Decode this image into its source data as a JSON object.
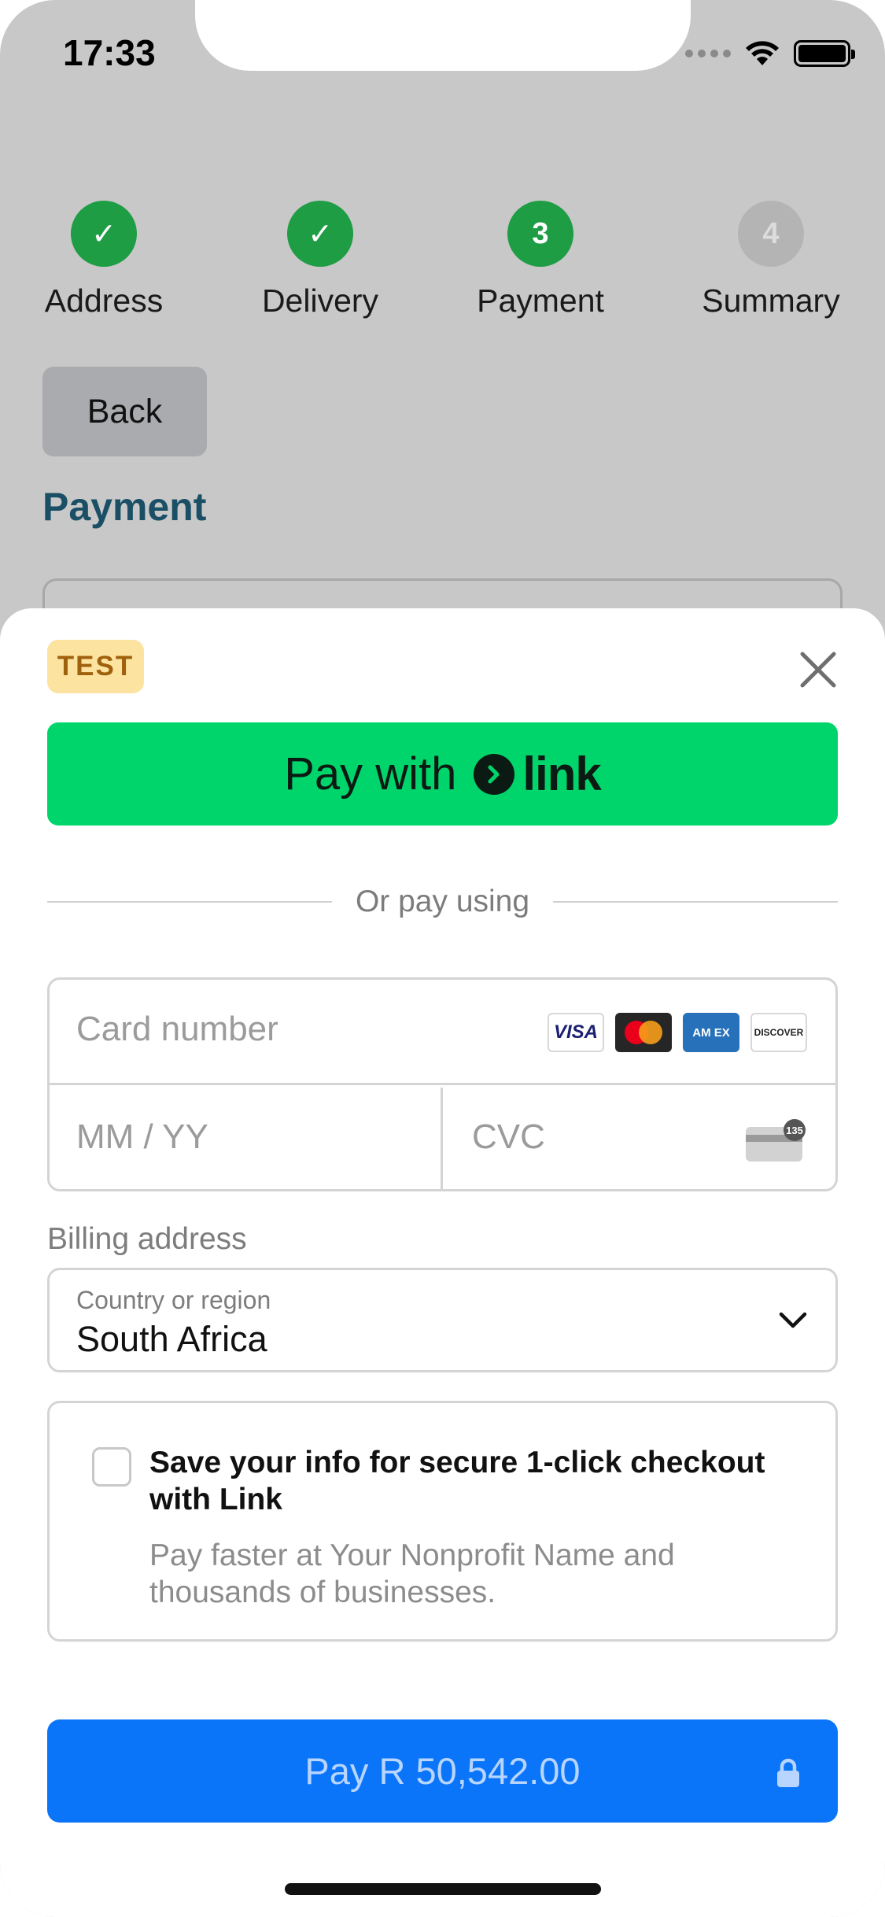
{
  "status_bar": {
    "time": "17:33",
    "icons": [
      "cellular-icon",
      "wifi-icon",
      "battery-icon"
    ]
  },
  "stepper": {
    "steps": [
      {
        "label": "Address",
        "state": "complete",
        "marker": "✓"
      },
      {
        "label": "Delivery",
        "state": "complete",
        "marker": "✓"
      },
      {
        "label": "Payment",
        "state": "current",
        "marker": "3"
      },
      {
        "label": "Summary",
        "state": "upcoming",
        "marker": "4"
      }
    ],
    "complete_color": "#1e9d44",
    "upcoming_color": "#b4b4b4"
  },
  "page": {
    "back_label": "Back",
    "heading": "Payment"
  },
  "sheet": {
    "test_badge": "TEST",
    "link_button": {
      "prefix": "Pay with",
      "brand": "link",
      "color": "#00d56c"
    },
    "divider_text": "Or pay using",
    "card": {
      "number_placeholder": "Card number",
      "brands": [
        "visa",
        "mastercard",
        "amex",
        "discover"
      ],
      "visa_text": "VISA",
      "amex_text": "AM EX",
      "discover_text": "DISCOVER",
      "expiry_placeholder": "MM / YY",
      "cvc_placeholder": "CVC",
      "cvc_icon_text": "135"
    },
    "billing": {
      "label": "Billing address",
      "country_label": "Country or region",
      "country_value": "South Africa"
    },
    "save_info": {
      "checked": false,
      "title": "Save your info for secure 1-click checkout with Link",
      "subtitle": "Pay faster at Your Nonprofit Name and thousands of businesses."
    },
    "pay_button": {
      "label": "Pay R 50,542.00",
      "color": "#0a75f9"
    }
  }
}
